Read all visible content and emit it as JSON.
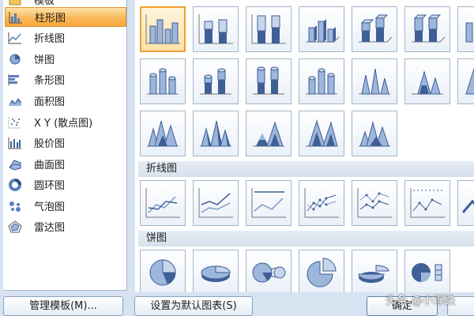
{
  "categories": [
    {
      "label": "模板",
      "icon": "folder-icon"
    },
    {
      "label": "柱形图",
      "icon": "column-chart-icon",
      "selected": true
    },
    {
      "label": "折线图",
      "icon": "line-chart-icon"
    },
    {
      "label": "饼图",
      "icon": "pie-chart-icon"
    },
    {
      "label": "条形图",
      "icon": "bar-chart-icon"
    },
    {
      "label": "面积图",
      "icon": "area-chart-icon"
    },
    {
      "label": "X Y (散点图)",
      "icon": "scatter-chart-icon"
    },
    {
      "label": "股价图",
      "icon": "stock-chart-icon"
    },
    {
      "label": "曲面图",
      "icon": "surface-chart-icon"
    },
    {
      "label": "圆环图",
      "icon": "doughnut-chart-icon"
    },
    {
      "label": "气泡图",
      "icon": "bubble-chart-icon"
    },
    {
      "label": "雷达图",
      "icon": "radar-chart-icon"
    }
  ],
  "sections": {
    "line": "折线图",
    "pie": "饼图"
  },
  "gallery_icons": {
    "column": [
      "clustered-column-icon",
      "stacked-column-icon",
      "100-stacked-column-icon",
      "3d-clustered-column-icon",
      "3d-stacked-column-icon",
      "3d-100-stacked-column-icon",
      "3d-column-icon",
      "clustered-cylinder-icon",
      "stacked-cylinder-icon",
      "100-stacked-cylinder-icon",
      "3d-cylinder-icon",
      "clustered-cone-icon",
      "stacked-cone-icon",
      "100-stacked-cone-icon",
      "3d-cone-icon",
      "clustered-pyramid-icon",
      "stacked-pyramid-icon",
      "100-stacked-pyramid-icon",
      "3d-pyramid-icon"
    ],
    "line": [
      "line-icon",
      "stacked-line-icon",
      "100-stacked-line-icon",
      "line-with-markers-icon",
      "stacked-line-with-markers-icon",
      "100-stacked-line-with-markers-icon",
      "3d-line-icon"
    ],
    "pie": [
      "pie-icon",
      "3d-pie-icon",
      "pie-of-pie-icon",
      "exploded-pie-icon",
      "3d-exploded-pie-icon",
      "bar-of-pie-icon"
    ]
  },
  "buttons": {
    "manage_templates": "管理模板(M)...",
    "set_default": "设置为默认图表(S)",
    "ok": "确定"
  },
  "watermark": "头条 @小浮跌",
  "colors": {
    "selection": "#f7a83a",
    "chart_blue": "#5b7fb8",
    "dialog_bg": "#d7e3f1"
  }
}
